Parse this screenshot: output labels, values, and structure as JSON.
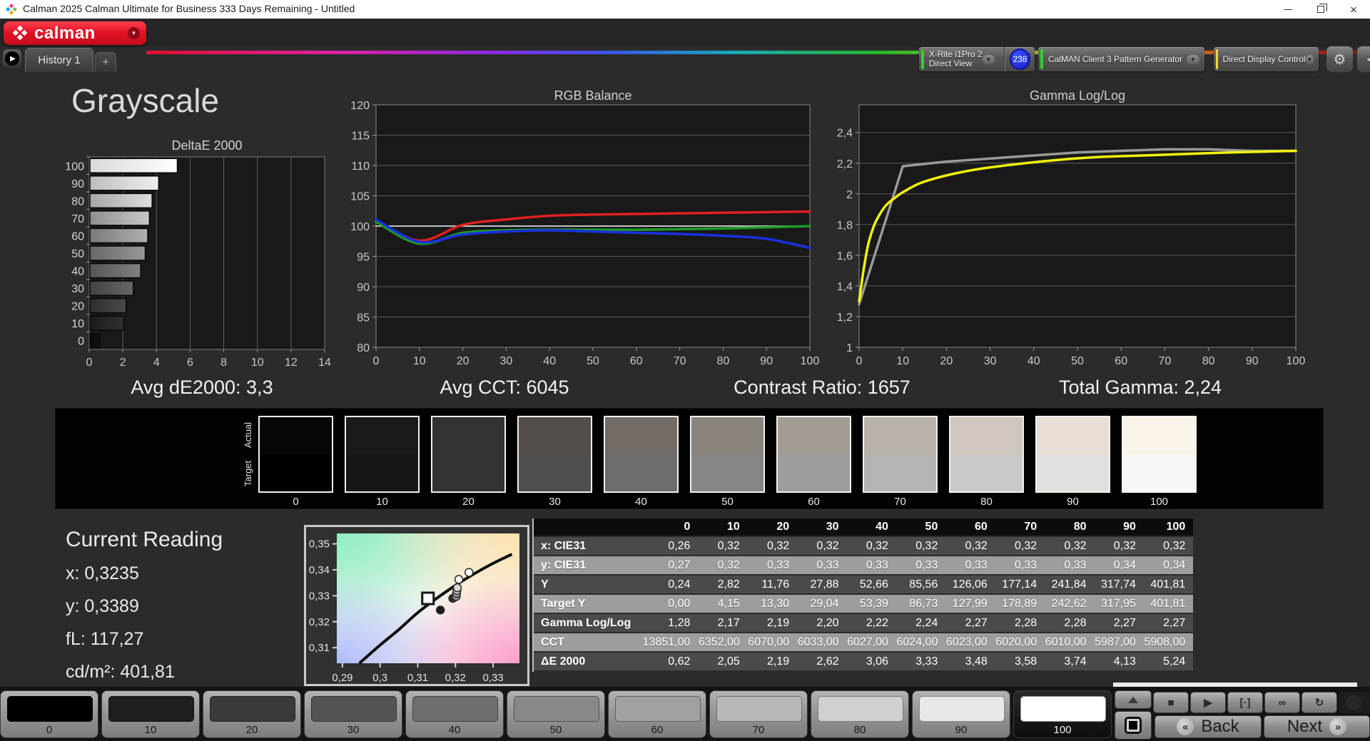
{
  "window": {
    "title": "Calman 2025 Calman Ultimate for Business 333 Days Remaining  - Untitled"
  },
  "icons": {
    "close": "×",
    "dropdown": "▼",
    "gear": "⚙",
    "collapse_left": "◀",
    "nav_play": "▶",
    "stop": "■",
    "play": "▶",
    "measure": "[·]",
    "loop": "∞",
    "refresh": "↻",
    "back_chevrons": "«",
    "next_chevrons": "»",
    "plus": "+"
  },
  "brand": {
    "logo_text": "calman",
    "accent_red": "#e51226"
  },
  "tabs": {
    "history": "History 1",
    "add": "+"
  },
  "devices": {
    "meter": {
      "line1": "X-Rite i1Pro 2",
      "line2": "Direct View",
      "badge": "238",
      "status_color": "#2ed12e",
      "badge_color": "#2335e8"
    },
    "pattern_generator": {
      "label": "CalMAN Client 3 Pattern Generator",
      "status_color": "#2ed12e"
    },
    "display_control": {
      "label": "Direct Display Control",
      "status_color": "#e8df25"
    }
  },
  "page_title": "Grayscale",
  "stats": [
    {
      "name": "avg-de2000",
      "text": "Avg dE2000: 3,3"
    },
    {
      "name": "avg-cct",
      "text": "Avg CCT: 6045"
    },
    {
      "name": "contrast-ratio",
      "text": "Contrast Ratio: 1657"
    },
    {
      "name": "total-gamma",
      "text": "Total Gamma: 2,24"
    }
  ],
  "chart_data": [
    {
      "type": "bar",
      "title": "DeltaE 2000",
      "orientation": "horizontal",
      "categories": [
        "100",
        "90",
        "80",
        "70",
        "60",
        "50",
        "40",
        "30",
        "20",
        "10",
        "0"
      ],
      "values": [
        5.24,
        4.13,
        3.74,
        3.58,
        3.48,
        3.33,
        3.06,
        2.62,
        2.19,
        2.05,
        0.62
      ],
      "xlim": [
        0,
        14
      ],
      "x_ticks": [
        0,
        2,
        4,
        6,
        8,
        10,
        12,
        14
      ],
      "bar_colors": [
        [
          "#d9d9d9",
          "#ffffff"
        ],
        [
          "#bcbcbc",
          "#efefef"
        ],
        [
          "#a6a6a6",
          "#dedede"
        ],
        [
          "#8f8f8f",
          "#c8c8c8"
        ],
        [
          "#7a7a7a",
          "#b0b0b0"
        ],
        [
          "#676767",
          "#989898"
        ],
        [
          "#555555",
          "#808080"
        ],
        [
          "#424242",
          "#666666"
        ],
        [
          "#2e2e2e",
          "#4a4a4a"
        ],
        [
          "#1c1c1c",
          "#303030"
        ],
        [
          "#0a0a0a",
          "#141414"
        ]
      ]
    },
    {
      "type": "line",
      "title": "RGB Balance",
      "x": [
        0,
        10,
        20,
        30,
        40,
        50,
        60,
        70,
        80,
        90,
        100
      ],
      "xlim": [
        0,
        100
      ],
      "x_ticks": [
        0,
        10,
        20,
        30,
        40,
        50,
        60,
        70,
        80,
        90,
        100
      ],
      "ylim": [
        80,
        120
      ],
      "y_gridlines": [
        80,
        85,
        90,
        95,
        100,
        105,
        110,
        115,
        120
      ],
      "y_tick_labels": [
        "80",
        "85",
        "90",
        "95",
        "100",
        "105",
        "110",
        "115",
        "120"
      ],
      "highlight_y": 100,
      "series": [
        {
          "name": "red-balance",
          "color": "#e02020",
          "smooth": true,
          "values": [
            101.0,
            97.6,
            100.2,
            101.1,
            101.7,
            101.9,
            102.0,
            102.1,
            102.2,
            102.3,
            102.4
          ]
        },
        {
          "name": "green-balance",
          "color": "#1f9a2c",
          "smooth": true,
          "values": [
            100.7,
            97.1,
            98.9,
            99.3,
            99.4,
            99.4,
            99.4,
            99.5,
            99.6,
            99.8,
            100.0
          ]
        },
        {
          "name": "blue-balance",
          "color": "#1a30e0",
          "smooth": true,
          "values": [
            101.1,
            97.4,
            98.6,
            99.1,
            99.3,
            99.1,
            98.9,
            98.7,
            98.4,
            97.9,
            96.4
          ]
        }
      ]
    },
    {
      "type": "line",
      "title": "Gamma Log/Log",
      "x": [
        0,
        10,
        20,
        30,
        40,
        50,
        60,
        70,
        80,
        90,
        100
      ],
      "xlim": [
        0,
        100
      ],
      "x_ticks": [
        0,
        10,
        20,
        30,
        40,
        50,
        60,
        70,
        80,
        90,
        100
      ],
      "ylim": [
        1,
        2.58
      ],
      "y_gridlines": [
        1,
        1.2,
        1.4,
        1.6,
        1.8,
        2,
        2.2,
        2.4
      ],
      "y_tick_labels": [
        "1",
        "1,2",
        "1,4",
        "1,6",
        "1,8",
        "2",
        "2,2",
        "2,4"
      ],
      "series": [
        {
          "name": "gamma-gray-line",
          "color": "#9a9a9a",
          "smooth": false,
          "values": [
            1.28,
            2.18,
            2.21,
            2.23,
            2.25,
            2.27,
            2.28,
            2.29,
            2.29,
            2.28,
            2.28
          ]
        },
        {
          "name": "gamma-yellow-line",
          "color": "#f2f20c",
          "smooth": true,
          "x": [
            0,
            1,
            2,
            3,
            4,
            6,
            8,
            10,
            14,
            20,
            27,
            35,
            45,
            55,
            65,
            75,
            85,
            100
          ],
          "values": [
            1.3,
            1.5,
            1.66,
            1.76,
            1.83,
            1.92,
            1.97,
            2.01,
            2.07,
            2.12,
            2.16,
            2.19,
            2.22,
            2.24,
            2.25,
            2.26,
            2.27,
            2.28
          ]
        }
      ]
    },
    {
      "type": "scatter",
      "title": "CIE chromaticity zoom",
      "xlim": [
        0.2885,
        0.337
      ],
      "ylim": [
        0.304,
        0.354
      ],
      "x_ticks": {
        "values": [
          0.29,
          0.3,
          0.31,
          0.32,
          0.33
        ],
        "labels": [
          "0,29",
          "0,3",
          "0,31",
          "0,32",
          "0,33"
        ]
      },
      "y_ticks": {
        "values": [
          0.35,
          0.34,
          0.33,
          0.32,
          0.31
        ],
        "labels": [
          "0,35",
          "0,34",
          "0,33",
          "0,32",
          "0,31"
        ]
      },
      "locus": [
        [
          0.2945,
          0.304
        ],
        [
          0.3,
          0.311
        ],
        [
          0.305,
          0.317
        ],
        [
          0.31,
          0.3235
        ],
        [
          0.315,
          0.329
        ],
        [
          0.32,
          0.334
        ],
        [
          0.325,
          0.3385
        ],
        [
          0.33,
          0.3425
        ],
        [
          0.335,
          0.346
        ]
      ],
      "target_marker": {
        "x": 0.3127,
        "y": 0.329
      },
      "points": [
        {
          "x": 0.316,
          "y": 0.3245,
          "fill": "#1c1c1c"
        },
        {
          "x": 0.3193,
          "y": 0.329,
          "fill": "#2a2a2a"
        },
        {
          "x": 0.3202,
          "y": 0.3297,
          "fill": "#8f8f8f"
        },
        {
          "x": 0.3203,
          "y": 0.3309,
          "fill": "#a8a8a8"
        },
        {
          "x": 0.3204,
          "y": 0.332,
          "fill": "#c2c2c2"
        },
        {
          "x": 0.3205,
          "y": 0.3331,
          "fill": "#d8d8d8"
        },
        {
          "x": 0.3209,
          "y": 0.3363,
          "fill": "#ffffff"
        },
        {
          "x": 0.3236,
          "y": 0.339,
          "fill": "#ffffff"
        }
      ]
    }
  ],
  "swatch_strip": {
    "row_labels": [
      "Actual",
      "Target"
    ],
    "levels": [
      "0",
      "10",
      "20",
      "30",
      "40",
      "50",
      "60",
      "70",
      "80",
      "90",
      "100"
    ],
    "actual_colors": [
      "#07070a",
      "#1b191a",
      "#353031",
      "#544e4b",
      "#736c66",
      "#8b847d",
      "#a39c94",
      "#b9b2aa",
      "#cfc7bd",
      "#e7dfd4",
      "#faf3e8"
    ],
    "target_colors": [
      "#010102",
      "#171717",
      "#323232",
      "#4e4e4e",
      "#6d6d6d",
      "#868686",
      "#9e9e9e",
      "#b4b4b3",
      "#cac9c7",
      "#e2e0dd",
      "#f8f7f5"
    ]
  },
  "current_reading": {
    "title": "Current Reading",
    "lines": [
      "x: 0,3235",
      "y: 0,3389",
      "fL: 117,27",
      "cd/m²: 401,81"
    ]
  },
  "table": {
    "columns": [
      "0",
      "10",
      "20",
      "30",
      "40",
      "50",
      "60",
      "70",
      "80",
      "90",
      "100"
    ],
    "rows": [
      {
        "label": "x: CIE31",
        "values": [
          "0,26",
          "0,32",
          "0,32",
          "0,32",
          "0,32",
          "0,32",
          "0,32",
          "0,32",
          "0,32",
          "0,32",
          "0,32"
        ]
      },
      {
        "label": "y: CIE31",
        "values": [
          "0,27",
          "0,32",
          "0,33",
          "0,33",
          "0,33",
          "0,33",
          "0,33",
          "0,33",
          "0,33",
          "0,34",
          "0,34"
        ]
      },
      {
        "label": "Y",
        "values": [
          "0,24",
          "2,82",
          "11,76",
          "27,88",
          "52,66",
          "85,56",
          "126,06",
          "177,14",
          "241,84",
          "317,74",
          "401,81"
        ]
      },
      {
        "label": "Target Y",
        "values": [
          "0,00",
          "4,15",
          "13,30",
          "29,04",
          "53,39",
          "86,73",
          "127,99",
          "178,89",
          "242,62",
          "317,95",
          "401,81"
        ]
      },
      {
        "label": "Gamma Log/Log",
        "values": [
          "1,28",
          "2,17",
          "2,19",
          "2,20",
          "2,22",
          "2,24",
          "2,27",
          "2,28",
          "2,28",
          "2,27",
          "2,27"
        ]
      },
      {
        "label": "CCT",
        "values": [
          "13851,00",
          "6352,00",
          "6070,00",
          "6033,00",
          "6027,00",
          "6024,00",
          "6023,00",
          "6020,00",
          "6010,00",
          "5987,00",
          "5908,00"
        ]
      },
      {
        "label": "ΔE 2000",
        "values": [
          "0,62",
          "2,05",
          "2,19",
          "2,62",
          "3,06",
          "3,33",
          "3,48",
          "3,58",
          "3,74",
          "4,13",
          "5,24"
        ]
      }
    ]
  },
  "bottom_bar": {
    "patches": [
      {
        "label": "0",
        "color": "#000000"
      },
      {
        "label": "10",
        "color": "#1e1e1e"
      },
      {
        "label": "20",
        "color": "#3a3a3a"
      },
      {
        "label": "30",
        "color": "#545454"
      },
      {
        "label": "40",
        "color": "#6e6e6e"
      },
      {
        "label": "50",
        "color": "#888888"
      },
      {
        "label": "60",
        "color": "#a0a0a0"
      },
      {
        "label": "70",
        "color": "#b8b8b8"
      },
      {
        "label": "80",
        "color": "#d0d0d0"
      },
      {
        "label": "90",
        "color": "#e8e8e8"
      },
      {
        "label": "100",
        "color": "#ffffff"
      }
    ],
    "selected_patch": "100",
    "transport": [
      {
        "name": "stop-button",
        "glyph": "■"
      },
      {
        "name": "play-button",
        "glyph": "▶"
      },
      {
        "name": "measure-button",
        "glyph": "[·]"
      },
      {
        "name": "continuous-button",
        "glyph": "∞"
      },
      {
        "name": "refresh-button",
        "glyph": "↻"
      }
    ],
    "back_label": "Back",
    "next_label": "Next"
  }
}
